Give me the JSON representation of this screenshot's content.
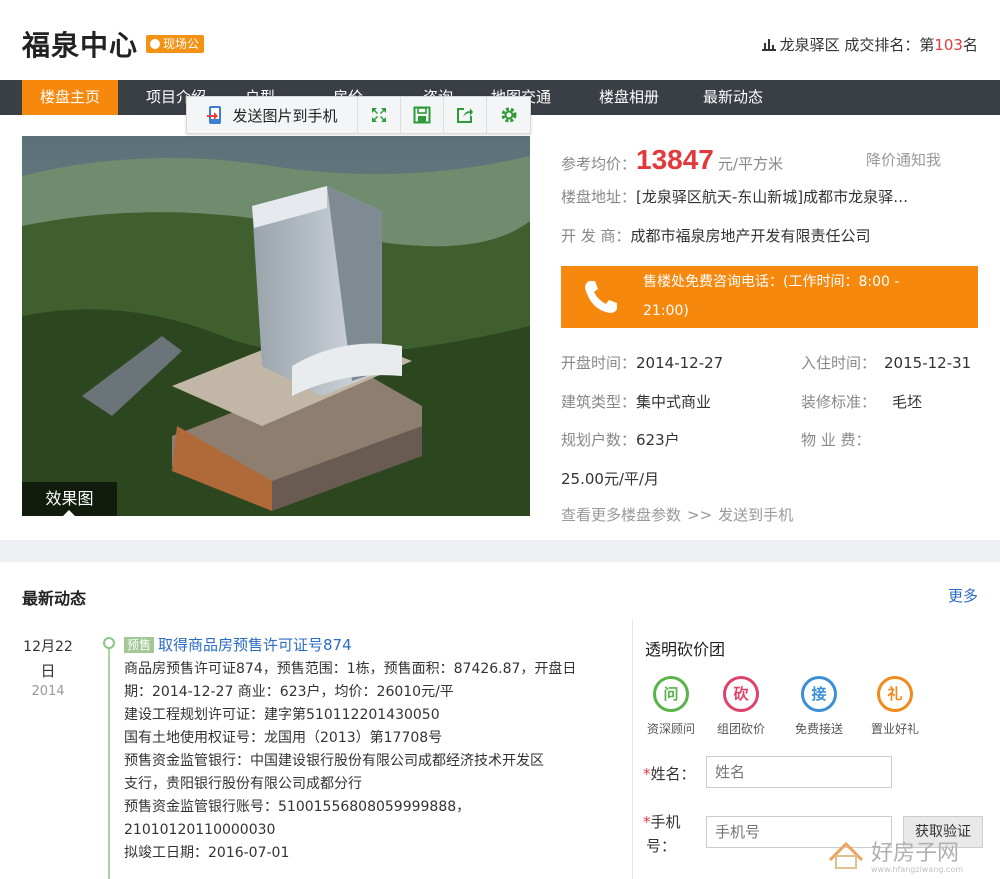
{
  "header": {
    "title": "福泉中心",
    "badge": "现场公",
    "district": "龙泉驿区 成交排名：第",
    "rank_num": "103",
    "rank_suffix": "名"
  },
  "nav": {
    "items": [
      "楼盘主页",
      "项目介绍",
      "户型",
      "房价",
      "咨询",
      "地图交通",
      "楼盘相册",
      "最新动态"
    ],
    "active_index": 0,
    "active_color": "#f7880e"
  },
  "toolbar": {
    "send_label": "发送图片到手机",
    "icons": [
      "fullscreen-icon",
      "save-icon",
      "share-icon",
      "settings-icon"
    ]
  },
  "photo": {
    "caption": "效果图"
  },
  "info": {
    "price_label": "参考均价：",
    "price": "13847",
    "price_unit": "元/平方米",
    "price_notify": "降价通知我",
    "address_label": "楼盘地址：",
    "address": "[龙泉驿区航天-东山新城]成都市龙泉驿…",
    "developer_label": "开 发 商：",
    "developer": "成都市福泉房地产开发有限责任公司",
    "hotline_1": "售楼处免费咨询电话：(工作时间：8:00 -",
    "hotline_2": "21:00)",
    "open_label": "开盘时间：",
    "open_date": "2014-12-27",
    "checkin_label": "入住时间：",
    "checkin_date": "2015-12-31",
    "type_label": "建筑类型：",
    "type": "集中式商业",
    "decor_label": "装修标准：",
    "decor": "毛坯",
    "units_label": "规划户数：",
    "units": "623户",
    "fee_label": "物 业 费：",
    "fee": "25.00元/平/月",
    "more_params": "查看更多楼盘参数",
    "send_phone": "发送到手机"
  },
  "news_section": {
    "title": "最新动态",
    "more": "更多",
    "date_md": "12月22",
    "date_d": "日",
    "date_y": "2014",
    "tag": "预售",
    "headline": "取得商品房预售许可证号874",
    "lines": [
      "商品房预售许可证874，预售范围：1栋，预售面积：87426.87，开盘日",
      "期：2014-12-27 商业：623户，均价：26010元/平",
      "建设工程规划许可证：建字第510112201430050",
      "国有土地使用权证号：龙国用（2013）第17708号",
      "预售资金监管银行：中国建设银行股份有限公司成都经济技术开发区",
      "支行，贵阳银行股份有限公司成都分行",
      "预售资金监管银行账号：51001556808059999888，21010120110000030",
      "拟竣工日期：2016-07-01"
    ]
  },
  "group_buy": {
    "title": "透明砍价团",
    "items": [
      {
        "char": "问",
        "label": "资深顾问",
        "color": "#5ab34a"
      },
      {
        "char": "砍",
        "label": "组团砍价",
        "color": "#e0436a"
      },
      {
        "char": "接",
        "label": "免费接送",
        "color": "#3a8fd6"
      },
      {
        "char": "礼",
        "label": "置业好礼",
        "color": "#f08a1c"
      }
    ],
    "name_label": "姓名：",
    "name_placeholder": "姓名",
    "phone_label_1": "手机",
    "phone_label_2": "号：",
    "phone_placeholder": "手机号",
    "get_code": "获取验证"
  },
  "watermark": {
    "brand": "好房子网",
    "url": "www.hfangziwang.com"
  }
}
